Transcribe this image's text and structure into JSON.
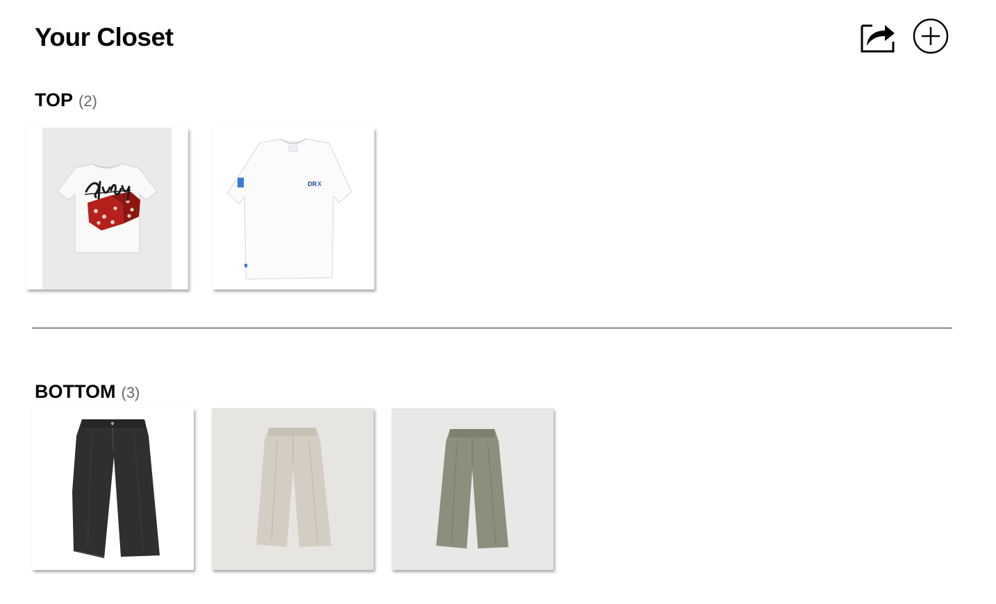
{
  "header": {
    "title": "Your Closet",
    "share_icon": "share-icon",
    "add_icon": "add-circle-icon"
  },
  "sections": {
    "top": {
      "label": "TOP",
      "count": "(2)",
      "items": [
        {
          "kind": "white t-shirt with red dice graphic",
          "brand_text": "Stussy"
        },
        {
          "kind": "white t-shirt with small logo",
          "brand_text": "DRX"
        }
      ]
    },
    "bottom": {
      "label": "BOTTOM",
      "count": "(3)",
      "items": [
        {
          "kind": "dark denim wide trousers",
          "color": "#2e2e2e"
        },
        {
          "kind": "beige pleated trousers",
          "color": "#cfc8bd"
        },
        {
          "kind": "olive green trousers",
          "color": "#8a8d7a"
        }
      ]
    }
  },
  "colors": {
    "photo_bg_gray": "#e9e8e6",
    "photo_bg_white": "#ffffff",
    "dice_red": "#b5201c",
    "drx_blue": "#2a6bd6"
  }
}
